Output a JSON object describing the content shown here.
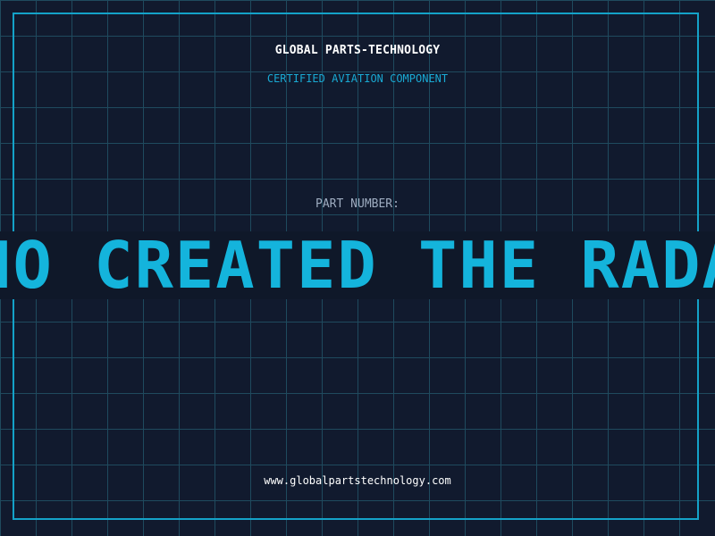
{
  "header": {
    "brand": "GLOBAL PARTS-TECHNOLOGY",
    "subtitle": "CERTIFIED AVIATION COMPONENT"
  },
  "part": {
    "label": "PART NUMBER:",
    "value": "WHO CREATED THE RADAR"
  },
  "footer": {
    "url": "www.globalpartstechnology.com"
  },
  "colors": {
    "background": "#111a2e",
    "grid": "#1f4a5e",
    "accent": "#14b4dc",
    "frame": "#14a2c8",
    "label": "#9eacc0",
    "text": "#ffffff"
  }
}
